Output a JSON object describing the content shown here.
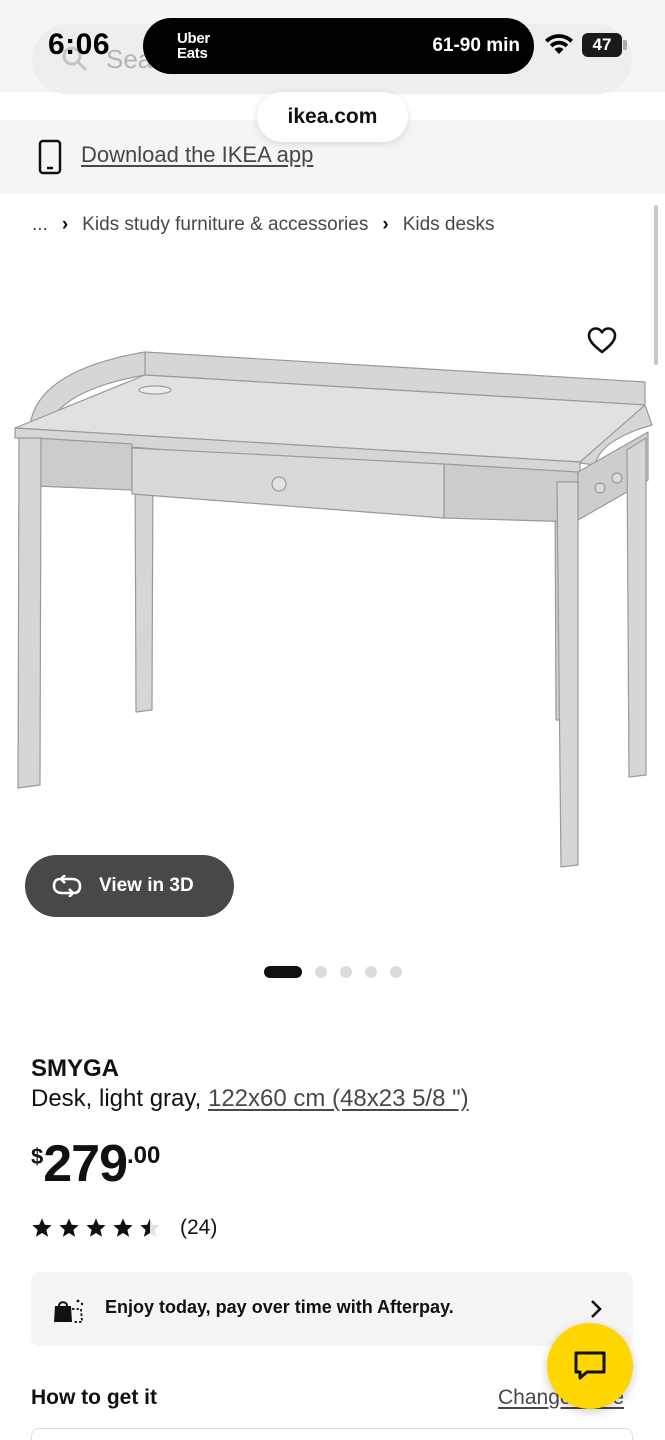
{
  "status_bar": {
    "time": "6:06",
    "live_activity": {
      "logo_line1": "Uber",
      "logo_line2": "Eats",
      "eta": "61-90 min"
    },
    "battery": "47"
  },
  "browser": {
    "domain": "ikea.com",
    "search_placeholder": "Sea"
  },
  "app_banner": {
    "label": "Download the IKEA app"
  },
  "breadcrumb": {
    "items": [
      "...",
      "Kids study furniture & accessories",
      "Kids desks"
    ]
  },
  "gallery": {
    "view_3d_label": "View in 3D",
    "total_images": 5,
    "active_index": 0
  },
  "product": {
    "name": "SMYGA",
    "description": "Desk, light gray,",
    "dimensions": "122x60 cm (48x23 5/8 \")",
    "price": {
      "currency": "$",
      "whole": "279",
      "decimal": ".00"
    },
    "rating": 4.5,
    "review_count": "(24)"
  },
  "afterpay": {
    "text": "Enjoy today, pay over time with Afterpay."
  },
  "delivery": {
    "title": "How to get it",
    "change_link": "Change store"
  },
  "colors": {
    "accent_yellow": "#ffd600",
    "dark_button": "#484848",
    "panel_gray": "#f5f5f5"
  }
}
